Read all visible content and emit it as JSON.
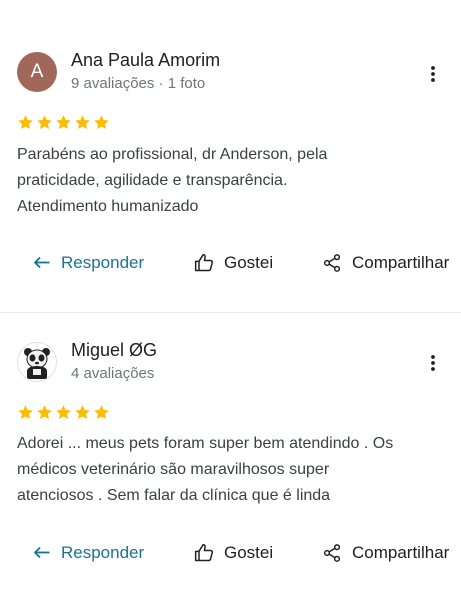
{
  "reviews": [
    {
      "avatar_letter": "A",
      "avatar_color": "#a1685a",
      "name": "Ana Paula Amorim",
      "meta": "9 avaliações · 1 foto",
      "rating": 5,
      "text": "Parabéns ao profissional, dr Anderson, pela\npraticidade, agilidade e transparência.\nAtendimento humanizado",
      "actions": {
        "reply": "Responder",
        "like": "Gostei",
        "share": "Compartilhar"
      }
    },
    {
      "avatar_icon": "panda-avatar-icon",
      "name": "Miguel ØG",
      "meta": "4 avaliações",
      "rating": 5,
      "text": "Adorei ... meus pets foram super bem atendindo . Os\nmédicos veterinário   são maravilhosos super\natenciosos . Sem falar da clínica que é linda",
      "actions": {
        "reply": "Responder",
        "like": "Gostei",
        "share": "Compartilhar"
      }
    }
  ],
  "colors": {
    "star": "#fbbc04",
    "reply": "#1a7390",
    "meta": "#70757a"
  }
}
